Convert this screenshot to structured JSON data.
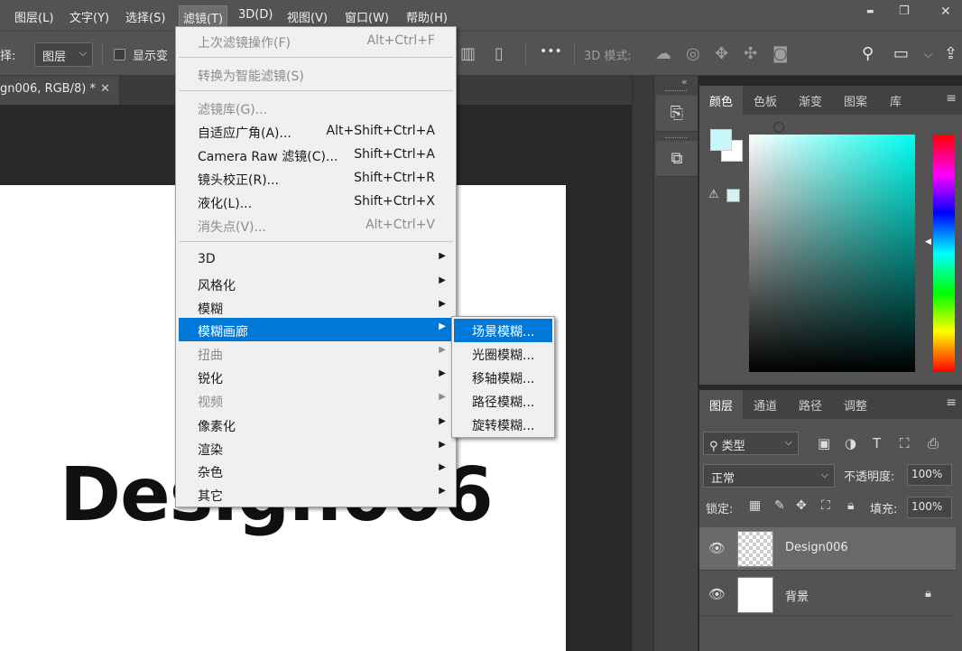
{
  "menubar": {
    "items": [
      "图层(L)",
      "文字(Y)",
      "选择(S)",
      "滤镜(T)",
      "3D(D)",
      "视图(V)",
      "窗口(W)",
      "帮助(H)"
    ],
    "active_index": 3
  },
  "window_controls": {
    "minimize": "▬",
    "restore": "❐",
    "close": "✕"
  },
  "options_bar": {
    "select_label": "择:",
    "select_value": "图层",
    "show_transform_label": "显示变",
    "more": "•••",
    "mode_3d_label": "3D 模式:"
  },
  "document_tab": {
    "title": "gn006, RGB/8) *",
    "close": "✕"
  },
  "canvas": {
    "text": "Design006"
  },
  "filter_menu": {
    "items": [
      {
        "label": "上次滤镜操作(F)",
        "shortcut": "Alt+Ctrl+F",
        "disabled": true
      },
      {
        "label": "转换为智能滤镜(S)",
        "shortcut": "",
        "disabled": true
      },
      {
        "label": "滤镜库(G)...",
        "shortcut": "",
        "disabled": true
      },
      {
        "label": "自适应广角(A)...",
        "shortcut": "Alt+Shift+Ctrl+A",
        "disabled": false
      },
      {
        "label": "Camera Raw 滤镜(C)...",
        "shortcut": "Shift+Ctrl+A",
        "disabled": false
      },
      {
        "label": "镜头校正(R)...",
        "shortcut": "Shift+Ctrl+R",
        "disabled": false
      },
      {
        "label": "液化(L)...",
        "shortcut": "Shift+Ctrl+X",
        "disabled": false
      },
      {
        "label": "消失点(V)...",
        "shortcut": "Alt+Ctrl+V",
        "disabled": true
      },
      {
        "label": "3D",
        "submenu": true,
        "disabled": false
      },
      {
        "label": "风格化",
        "submenu": true,
        "disabled": false
      },
      {
        "label": "模糊",
        "submenu": true,
        "disabled": false
      },
      {
        "label": "模糊画廊",
        "submenu": true,
        "disabled": false,
        "highlight": true
      },
      {
        "label": "扭曲",
        "submenu": true,
        "disabled": true
      },
      {
        "label": "锐化",
        "submenu": true,
        "disabled": false
      },
      {
        "label": "视频",
        "submenu": true,
        "disabled": true
      },
      {
        "label": "像素化",
        "submenu": true,
        "disabled": false
      },
      {
        "label": "渲染",
        "submenu": true,
        "disabled": false
      },
      {
        "label": "杂色",
        "submenu": true,
        "disabled": false
      },
      {
        "label": "其它",
        "submenu": true,
        "disabled": false
      }
    ]
  },
  "blur_gallery_submenu": {
    "items": [
      "场景模糊...",
      "光圈模糊...",
      "移轴模糊...",
      "路径模糊...",
      "旋转模糊..."
    ],
    "highlight_index": 0
  },
  "color_panel": {
    "tabs": [
      "颜色",
      "色板",
      "渐变",
      "图案",
      "库"
    ],
    "foreground": "#c8f8fb",
    "background": "#ffffff",
    "warning_swatch": "#d6f0f2"
  },
  "layers_panel": {
    "tabs": [
      "图层",
      "通道",
      "路径",
      "调整"
    ],
    "filter_label": "类型",
    "blend_mode": "正常",
    "opacity_label": "不透明度:",
    "opacity_value": "100%",
    "lock_label": "锁定:",
    "fill_label": "填充:",
    "fill_value": "100%",
    "layers": [
      {
        "name": "Design006",
        "selected": true
      },
      {
        "name": "背景",
        "selected": false,
        "locked": true
      }
    ]
  },
  "colors": {
    "menu_highlight": "#0078d7",
    "panel_bg": "#535353",
    "app_bg": "#282828"
  }
}
